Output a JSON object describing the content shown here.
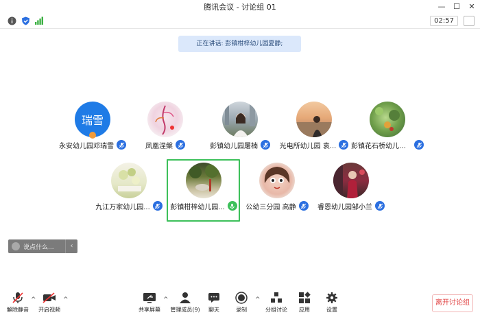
{
  "window": {
    "title": "腾讯会议 - 讨论组 01"
  },
  "toolbar": {
    "timer": "02:57"
  },
  "speaking": {
    "text": "正在讲话: 彭镇柑梓幼儿园夏静;"
  },
  "participants": [
    {
      "name": "永安幼儿园邓瑞雪",
      "avatar_text": "瑞雪",
      "avatar_color": "#1f7be6"
    },
    {
      "name": "凤凰涅槃"
    },
    {
      "name": "彭镇幼儿园屠楠"
    },
    {
      "name": "光电所幼儿园 袁..."
    },
    {
      "name": "彭镇花石桥幼儿园..."
    },
    {
      "name": "九江万家幼儿园..."
    },
    {
      "name": "彭镇柑梓幼儿园..."
    },
    {
      "name": "公幼三分园 高静"
    },
    {
      "name": "睿恩幼儿园邹小兰"
    }
  ],
  "chat": {
    "placeholder": "说点什么..."
  },
  "bottom": {
    "mute": "解除静音",
    "video": "开启视频",
    "share": "共享屏幕",
    "members": "管理成员(9)",
    "chat": "聊天",
    "record": "录制",
    "breakout": "分组讨论",
    "apps": "应用",
    "settings": "设置",
    "leave": "离开讨论组"
  },
  "colors": {
    "accent": "#2b6fe0",
    "active": "#3cc05a",
    "leave": "#e04040"
  }
}
